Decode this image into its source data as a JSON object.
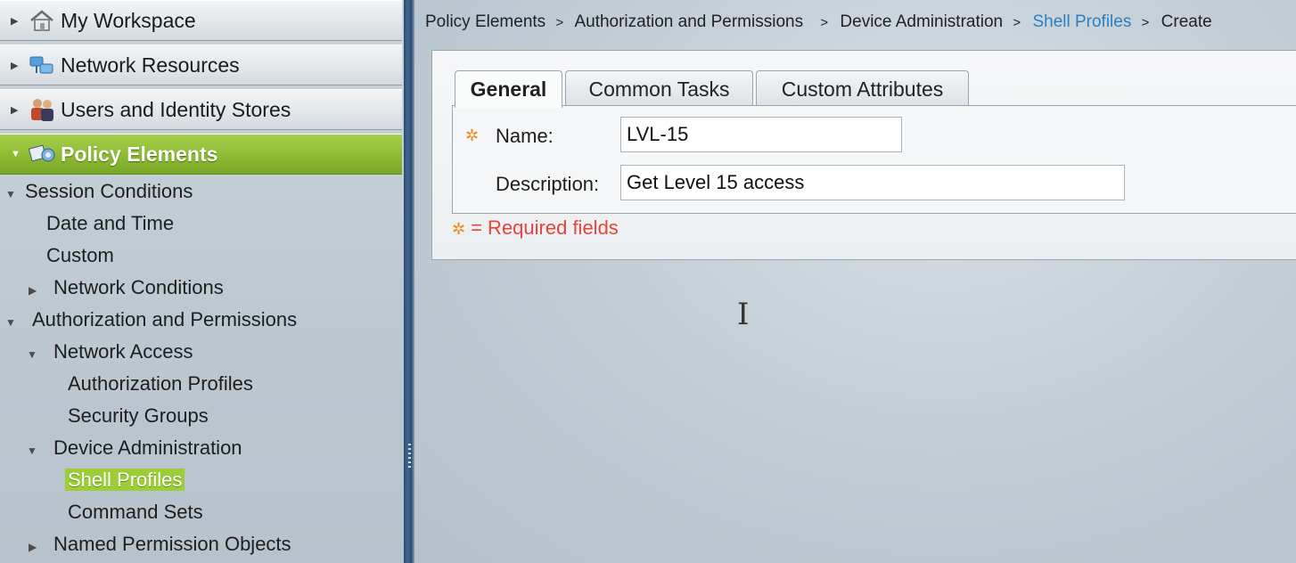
{
  "sidebar": {
    "drawers": [
      {
        "label": "My Workspace",
        "icon": "workspace-icon"
      },
      {
        "label": "Network Resources",
        "icon": "network-resources-icon"
      },
      {
        "label": "Users and Identity Stores",
        "icon": "users-icon"
      },
      {
        "label": "Policy Elements",
        "icon": "policy-elements-icon",
        "active": true
      }
    ],
    "tree": {
      "session_conditions": "Session Conditions",
      "date_and_time": "Date and Time",
      "custom": "Custom",
      "network_conditions": "Network Conditions",
      "authorization_and_permissions": "Authorization and Permissions",
      "network_access": "Network Access",
      "authorization_profiles": "Authorization Profiles",
      "security_groups": "Security Groups",
      "device_administration": "Device Administration",
      "shell_profiles": "Shell Profiles",
      "command_sets": "Command Sets",
      "named_permission_objects": "Named Permission Objects"
    }
  },
  "breadcrumb": {
    "items": [
      "Policy Elements",
      "Authorization and Permissions",
      "Device Administration",
      "Shell Profiles",
      "Create"
    ],
    "separator": ">"
  },
  "tabs": [
    "General",
    "Common Tasks",
    "Custom Attributes"
  ],
  "form": {
    "name_label": "Name:",
    "name_value": "LVL-15",
    "description_label": "Description:",
    "description_value": "Get Level 15 access",
    "required_note": "= Required fields"
  },
  "colors": {
    "accent_green": "#8dbb32",
    "link_blue": "#2b7fc2",
    "required_red": "#e8433a",
    "required_star": "#f08a1c"
  }
}
